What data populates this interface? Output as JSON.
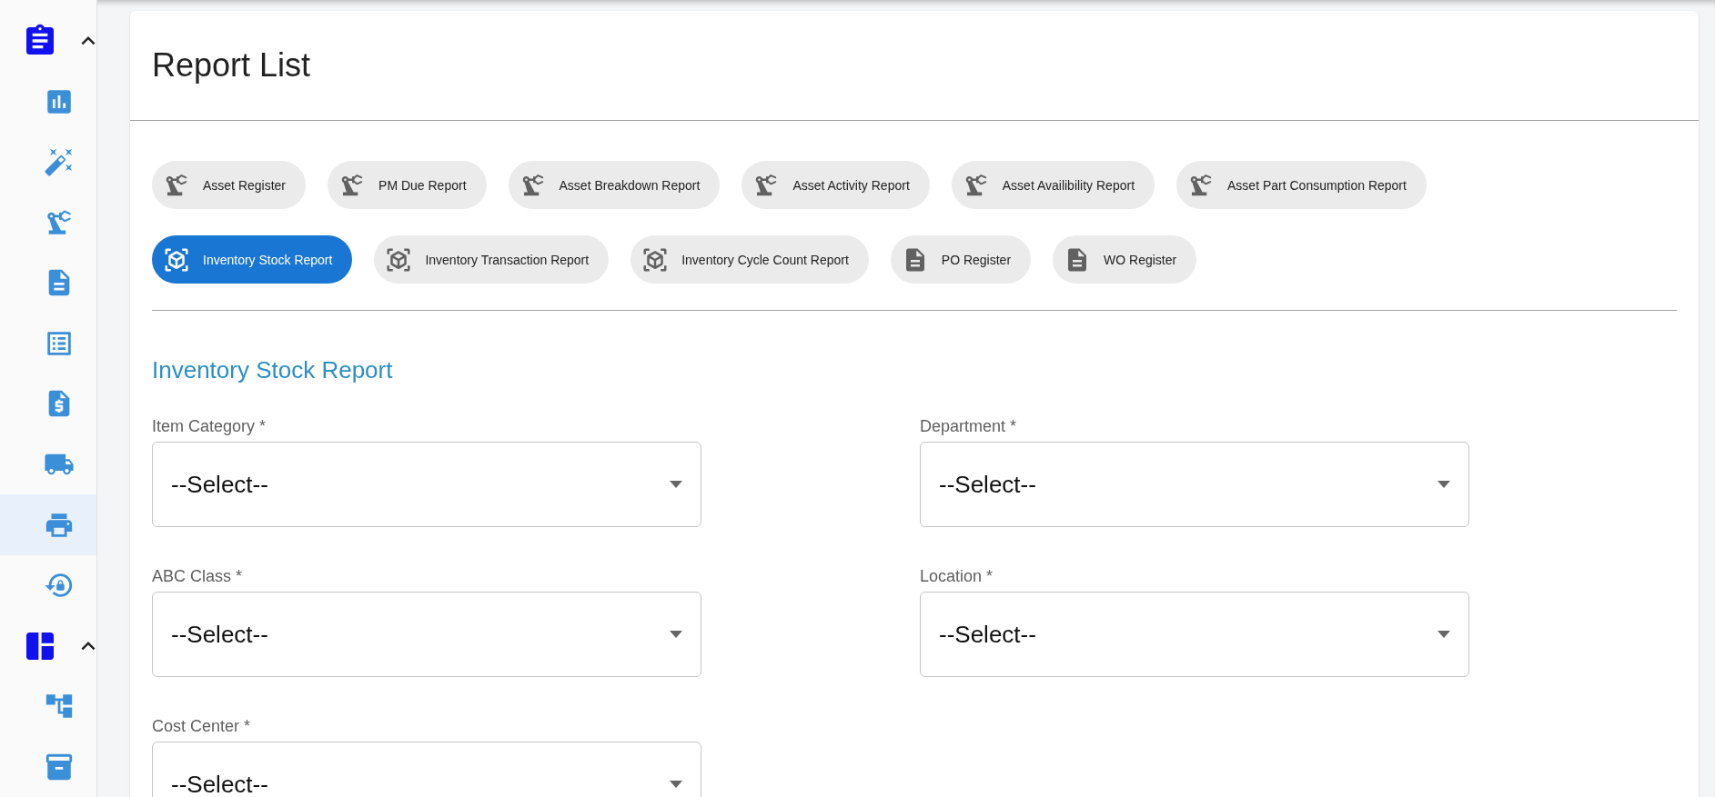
{
  "sidebar": {
    "groups": [
      {
        "kind": "clipboard",
        "expanded": true,
        "items": [
          {
            "kind": "chart",
            "selected": false
          },
          {
            "kind": "wand",
            "selected": false
          },
          {
            "kind": "robot",
            "selected": false
          },
          {
            "kind": "document",
            "selected": false
          },
          {
            "kind": "list",
            "selected": false
          },
          {
            "kind": "invoice",
            "selected": false
          },
          {
            "kind": "truck",
            "selected": false
          },
          {
            "kind": "printer",
            "selected": true
          },
          {
            "kind": "lockreset",
            "selected": false
          }
        ]
      },
      {
        "kind": "applink",
        "expanded": true,
        "items": [
          {
            "kind": "hierarchy",
            "selected": false
          },
          {
            "kind": "archive",
            "selected": false
          }
        ]
      }
    ]
  },
  "page": {
    "title": "Report List"
  },
  "report_chips": [
    [
      {
        "label": "Asset Register",
        "kind": "asset",
        "selected": false
      },
      {
        "label": "PM Due Report",
        "kind": "asset",
        "selected": false
      },
      {
        "label": "Asset Breakdown Report",
        "kind": "asset",
        "selected": false
      },
      {
        "label": "Asset Activity Report",
        "kind": "asset",
        "selected": false
      },
      {
        "label": "Asset Availibility Report",
        "kind": "asset",
        "selected": false
      },
      {
        "label": "Asset Part Consumption Report",
        "kind": "asset",
        "selected": false
      }
    ],
    [
      {
        "label": "Inventory Stock Report",
        "kind": "inventory",
        "selected": true
      },
      {
        "label": "Inventory Transaction Report",
        "kind": "inventory",
        "selected": false
      },
      {
        "label": "Inventory Cycle Count Report",
        "kind": "inventory",
        "selected": false
      },
      {
        "label": "PO Register",
        "kind": "document",
        "selected": false
      },
      {
        "label": "WO Register",
        "kind": "document",
        "selected": false
      }
    ]
  ],
  "form": {
    "title": "Inventory Stock Report",
    "fields": [
      {
        "label": "Item Category *",
        "value": "--Select--"
      },
      {
        "label": "Department *",
        "value": "--Select--"
      },
      {
        "label": "ABC Class *",
        "value": "--Select--"
      },
      {
        "label": "Location *",
        "value": "--Select--"
      },
      {
        "label": "Cost Center *",
        "value": "--Select--"
      }
    ]
  }
}
